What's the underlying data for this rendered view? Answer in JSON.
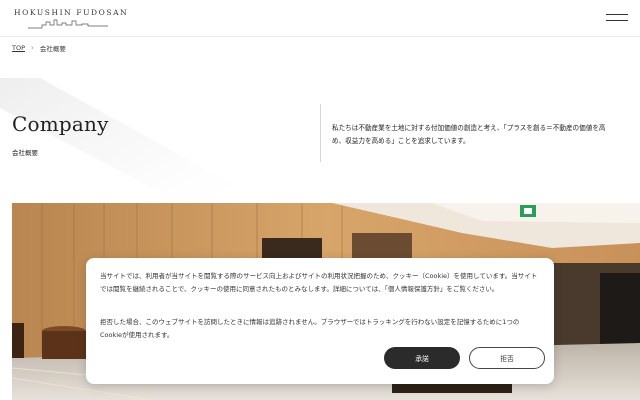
{
  "header": {
    "logo_text": "HOKUSHIN FUDOSAN",
    "menu_icon": "hamburger-icon"
  },
  "breadcrumb": {
    "items": [
      "TOP",
      "会社概要"
    ],
    "separator_icon": "chevron-right-icon"
  },
  "hero": {
    "title": "Company",
    "subtitle": "会社概要",
    "intro_line1": "私たちは不動産業を土地に対する付加価値の創造と考え、「プラスを創る＝不動産の価値を高",
    "intro_line2": "め、収益力を高める」ことを追求しています。"
  },
  "cookie_banner": {
    "paragraph1": "当サイトでは、利用者が当サイトを閲覧する際のサービス向上およびサイトの利用状況把握のため、クッキー（Cookie）を使用しています。当サイトでは閲覧を継続されることで、クッキーの使用に同意されたものとみなします。詳細については、「個人情報保護方針」をご覧ください。",
    "paragraph2": "拒否した場合、このウェブサイトを訪問したときに情報は追跡されません。ブラウザーではトラッキングを行わない設定を記憶するために1つのCookieが使用されます。",
    "accept_label": "承諾",
    "reject_label": "拒否"
  },
  "colors": {
    "accent_dark": "#2b2b2b",
    "wood": "#c9945c",
    "exit_sign": "#2a9d5c"
  }
}
